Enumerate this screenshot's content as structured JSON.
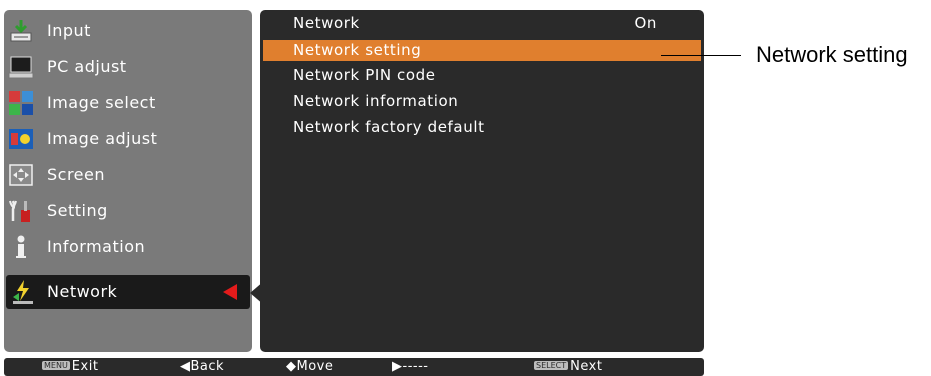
{
  "menu": {
    "items": [
      {
        "label": "Input",
        "icon": "input-icon"
      },
      {
        "label": "PC adjust",
        "icon": "pc-adjust-icon"
      },
      {
        "label": "Image select",
        "icon": "image-select-icon"
      },
      {
        "label": "Image adjust",
        "icon": "image-adjust-icon"
      },
      {
        "label": "Screen",
        "icon": "screen-icon"
      },
      {
        "label": "Setting",
        "icon": "setting-icon"
      },
      {
        "label": "Information",
        "icon": "information-icon"
      },
      {
        "label": "Network",
        "icon": "network-icon",
        "selected": true
      }
    ]
  },
  "submenu": {
    "items": [
      {
        "label": "Network",
        "value": "On"
      },
      {
        "label": "Network setting",
        "highlighted": true
      },
      {
        "label": "Network PIN code"
      },
      {
        "label": "Network information"
      },
      {
        "label": "Network factory default"
      }
    ]
  },
  "footer": {
    "exit_key": "MENU",
    "exit": "Exit",
    "back": "Back",
    "move": "Move",
    "next_dashes": "-----",
    "select_key": "SELECT",
    "next": "Next"
  },
  "callout": {
    "label": "Network setting"
  },
  "colors": {
    "highlight": "#e07f2e",
    "menu_bg": "#7a7a7a",
    "panel_bg": "#2a2a2a",
    "arrow": "#e41b1b"
  }
}
